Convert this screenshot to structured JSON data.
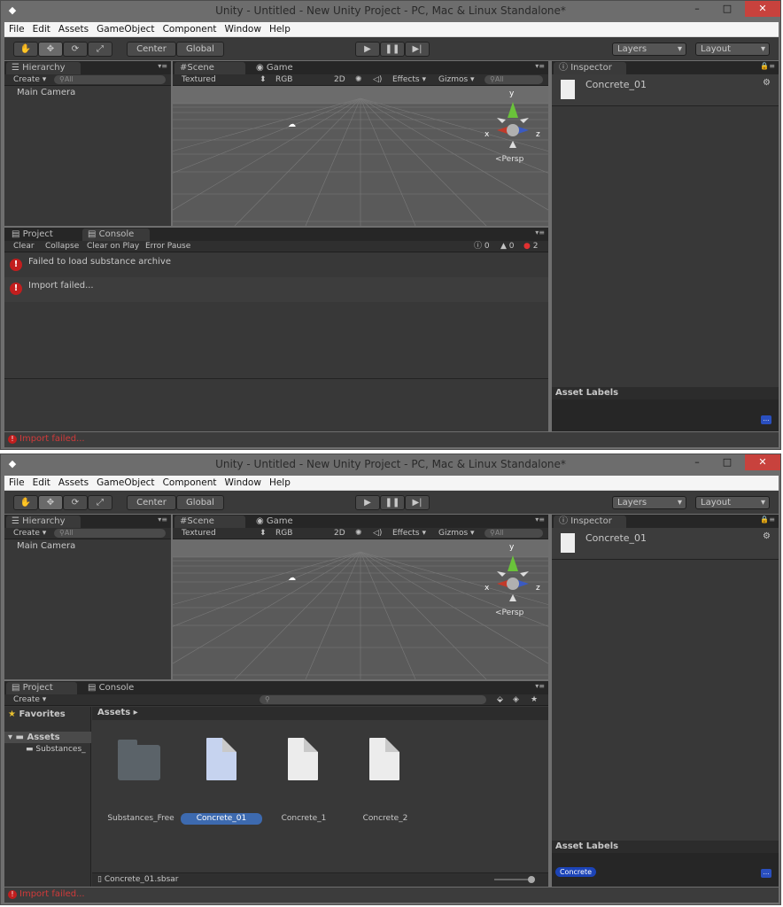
{
  "title": "Unity - Untitled - New Unity Project - PC, Mac & Linux Standalone*",
  "window_controls": {
    "minimize": "–",
    "maximize": "□",
    "close": "✕"
  },
  "menu": [
    "File",
    "Edit",
    "Assets",
    "GameObject",
    "Component",
    "Window",
    "Help"
  ],
  "toolbar": {
    "center": "Center",
    "global": "Global",
    "layers": "Layers",
    "layout": "Layout"
  },
  "hierarchy": {
    "tab": "Hierarchy",
    "create": "Create",
    "search": "All",
    "items": [
      "Main Camera"
    ]
  },
  "scene": {
    "tab": "Scene",
    "game_tab": "Game",
    "shading": "Textured",
    "rgb": "RGB",
    "mode2d": "2D",
    "effects": "Effects",
    "gizmos": "Gizmos",
    "search": "All",
    "persp": "Persp",
    "axis": {
      "x": "x",
      "y": "y",
      "z": "z"
    }
  },
  "inspector": {
    "tab": "Inspector",
    "object": "Concrete_01",
    "asset_labels": "Asset Labels",
    "label_tag": "Concrete"
  },
  "console": {
    "project_tab": "Project",
    "console_tab": "Console",
    "buttons": [
      "Clear",
      "Collapse",
      "Clear on Play",
      "Error Pause"
    ],
    "counts": {
      "info": "0",
      "warn": "0",
      "error": "2"
    },
    "messages": [
      "Failed to load substance archive",
      "Import failed..."
    ]
  },
  "project": {
    "create": "Create",
    "favorites": "Favorites",
    "assets": "Assets",
    "folder": "Substances_",
    "breadcrumb": "Assets",
    "items": [
      "Substances_Free",
      "Concrete_01",
      "Concrete_1",
      "Concrete_2"
    ],
    "selected_file": "Concrete_01.sbsar"
  },
  "status": "Import failed...",
  "colors": {
    "accent": "#3d73c4",
    "error": "#c21e1e",
    "close": "#c8423d"
  }
}
